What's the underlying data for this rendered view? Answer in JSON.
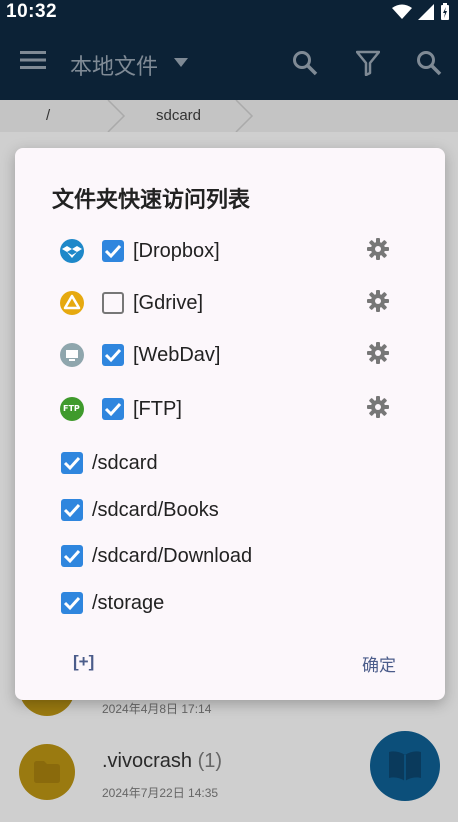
{
  "status": {
    "time": "10:32"
  },
  "appbar": {
    "title": "本地文件"
  },
  "breadcrumb": {
    "root": "/",
    "current": "sdcard"
  },
  "files": [
    {
      "name": "",
      "count": "",
      "date": "2024年4月8日 17:14"
    },
    {
      "name": ".vivocrash",
      "count": "(1)",
      "date": "2024年7月22日 14:35"
    }
  ],
  "dialog": {
    "title": "文件夹快速访问列表",
    "services": [
      {
        "label": "[Dropbox]",
        "checked": true,
        "icon": "dropbox-icon",
        "color": "#1e88c9"
      },
      {
        "label": "[Gdrive]",
        "checked": false,
        "icon": "gdrive-icon",
        "color": "#e6a90f"
      },
      {
        "label": "[WebDav]",
        "checked": true,
        "icon": "webdav-icon",
        "color": "#8fa6ad"
      },
      {
        "label": "[FTP]",
        "checked": true,
        "icon": "ftp-icon",
        "color": "#3f9a2c"
      }
    ],
    "paths": [
      {
        "label": "/sdcard",
        "checked": true
      },
      {
        "label": "/sdcard/Books",
        "checked": true
      },
      {
        "label": "/sdcard/Download",
        "checked": true
      },
      {
        "label": "/storage",
        "checked": true
      }
    ],
    "add_label": "[+]",
    "ok_label": "确定"
  }
}
